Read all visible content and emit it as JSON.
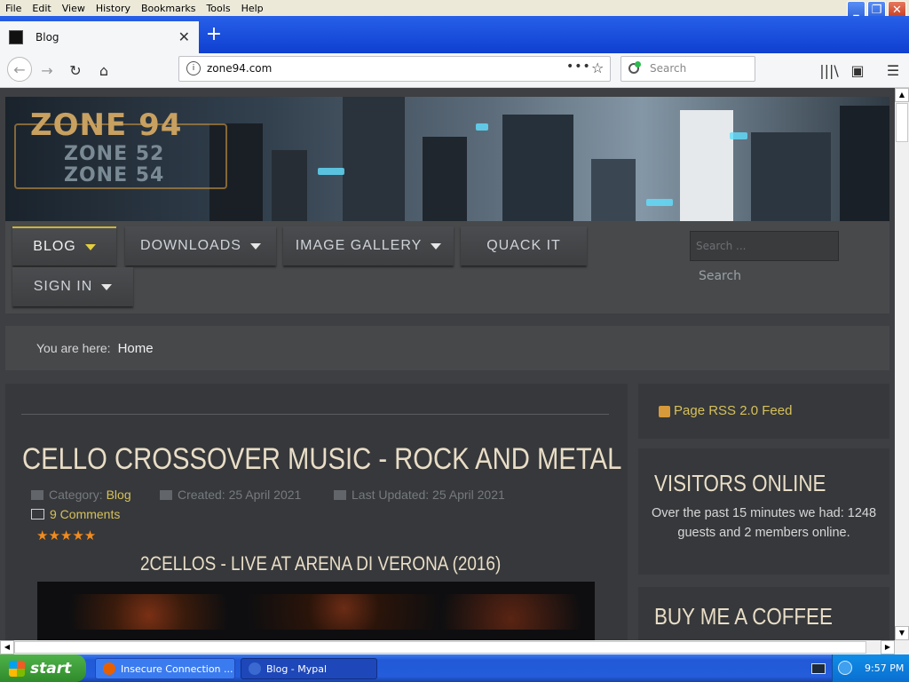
{
  "browser": {
    "menu": [
      "File",
      "Edit",
      "View",
      "History",
      "Bookmarks",
      "Tools",
      "Help"
    ],
    "tab_title": "Blog",
    "new_tab": "+",
    "url": "zone94.com",
    "search_placeholder": "Search"
  },
  "site": {
    "logo_main": "ZONE 94",
    "logo_sub1": "ZONE 52",
    "logo_sub2": "ZONE 54",
    "nav": {
      "blog": "BLOG",
      "downloads": "DOWNLOADS",
      "gallery": "IMAGE GALLERY",
      "quack": "QUACK IT",
      "signin": "SIGN IN"
    },
    "search_placeholder": "Search ...",
    "search_button": "Search",
    "breadcrumb_label": "You are here:",
    "breadcrumb_home": "Home",
    "article": {
      "title": "CELLO CROSSOVER MUSIC - ROCK AND METAL",
      "category_label": "Category:",
      "category": "Blog",
      "created": "Created: 25 April 2021",
      "updated": "Last Updated: 25 April 2021",
      "comments": "9 Comments",
      "rating_stars": 5,
      "stars_text": "★★★★★",
      "video_title": "2CELLOS - LIVE AT ARENA DI VERONA (2016)"
    },
    "sidebar": {
      "rss": "Page RSS 2.0 Feed",
      "visitors_title": "VISITORS ONLINE",
      "visitors_text": "Over the past 15 minutes we had: 1248 guests and 2 members online.",
      "coffee_title": "BUY ME A COFFEE"
    }
  },
  "taskbar": {
    "start": "start",
    "task1": "Insecure Connection ...",
    "task2": "Blog - Mypal",
    "clock": "9:57 PM"
  },
  "colors": {
    "accent_yellow": "#d7c15a",
    "heading_cream": "#e9ddc6",
    "star_orange": "#f28b1e"
  }
}
